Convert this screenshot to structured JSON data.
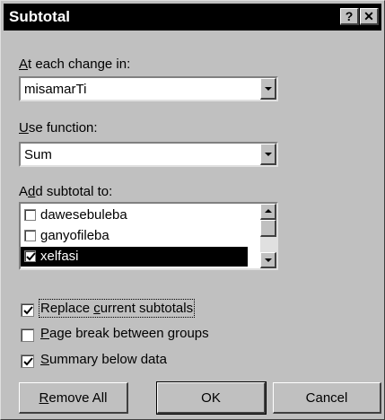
{
  "title": "Subtotal",
  "title_buttons": {
    "help": "?",
    "close": "✕"
  },
  "at_each_change": {
    "label_hot": "A",
    "label_rest": "t each change in:",
    "value": "misamarTi"
  },
  "use_function": {
    "label_hot": "U",
    "label_rest": "se function:",
    "value": "Sum"
  },
  "add_subtotal": {
    "label_pre": "A",
    "label_hot": "d",
    "label_rest": "d subtotal to:",
    "items": [
      {
        "label": "dawesebuleba",
        "checked": false,
        "selected": false
      },
      {
        "label": "ganyofileba",
        "checked": false,
        "selected": false
      },
      {
        "label": "xelfasi",
        "checked": true,
        "selected": true
      }
    ]
  },
  "options": {
    "replace": {
      "pre": "Replace ",
      "hot": "c",
      "rest": "urrent subtotals",
      "checked": true
    },
    "page_break": {
      "pre": "",
      "hot": "P",
      "rest": "age break between groups",
      "checked": false
    },
    "summary": {
      "pre": "",
      "hot": "S",
      "rest": "ummary below data",
      "checked": true
    }
  },
  "buttons": {
    "remove_all": {
      "hot": "R",
      "rest": "emove All"
    },
    "ok": "OK",
    "cancel": "Cancel"
  }
}
